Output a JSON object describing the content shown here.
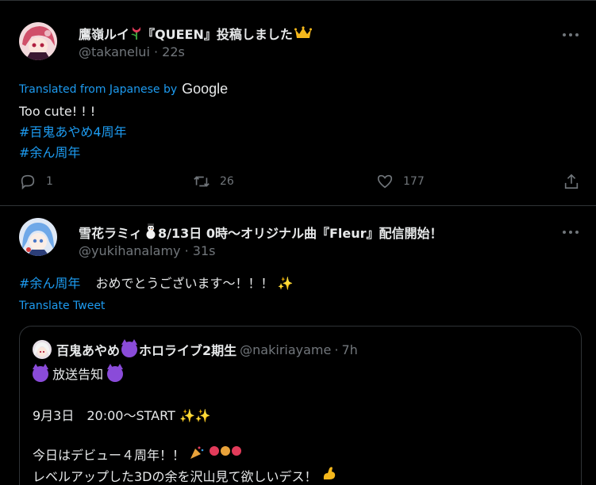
{
  "tweets": [
    {
      "name": "鷹嶺ルイ",
      "name_suffix": "『QUEEN』投稿しました",
      "handle": "@takanelui",
      "time": "22s",
      "translated_label": "Translated from Japanese by",
      "translator": "Google",
      "lines": [
        "Too cute! ! !",
        "#百鬼あやめ4周年",
        "#余ん周年"
      ],
      "replies": "1",
      "retweets": "26",
      "likes": "177"
    },
    {
      "name": "雪花ラミィ",
      "name_suffix": "8/13日 0時〜オリジナル曲『Fleur』配信開始！",
      "handle": "@yukihanalamy",
      "time": "31s",
      "tag": "#余ん周年",
      "text": "おめでとうございます〜！！！",
      "translate_label": "Translate Tweet",
      "quote": {
        "name": "百鬼あやめ",
        "name_suffix": "ホロライブ2期生",
        "handle": "@nakiriayame",
        "time": "7h",
        "line1": "放送告知",
        "line2": "9月3日　20:00〜START",
        "line3": "今日はデビュー４周年！！",
        "line4": "レベルアップした3Dの余を沢山見て欲しいデス！"
      }
    }
  ],
  "separator": "·",
  "icons": [
    "more-icon",
    "reply-icon",
    "retweet-icon",
    "like-icon",
    "share-icon"
  ],
  "colors": {
    "background": "#000000",
    "link": "#1d9bf0",
    "muted": "#71767b",
    "text": "#e7e9ea"
  }
}
